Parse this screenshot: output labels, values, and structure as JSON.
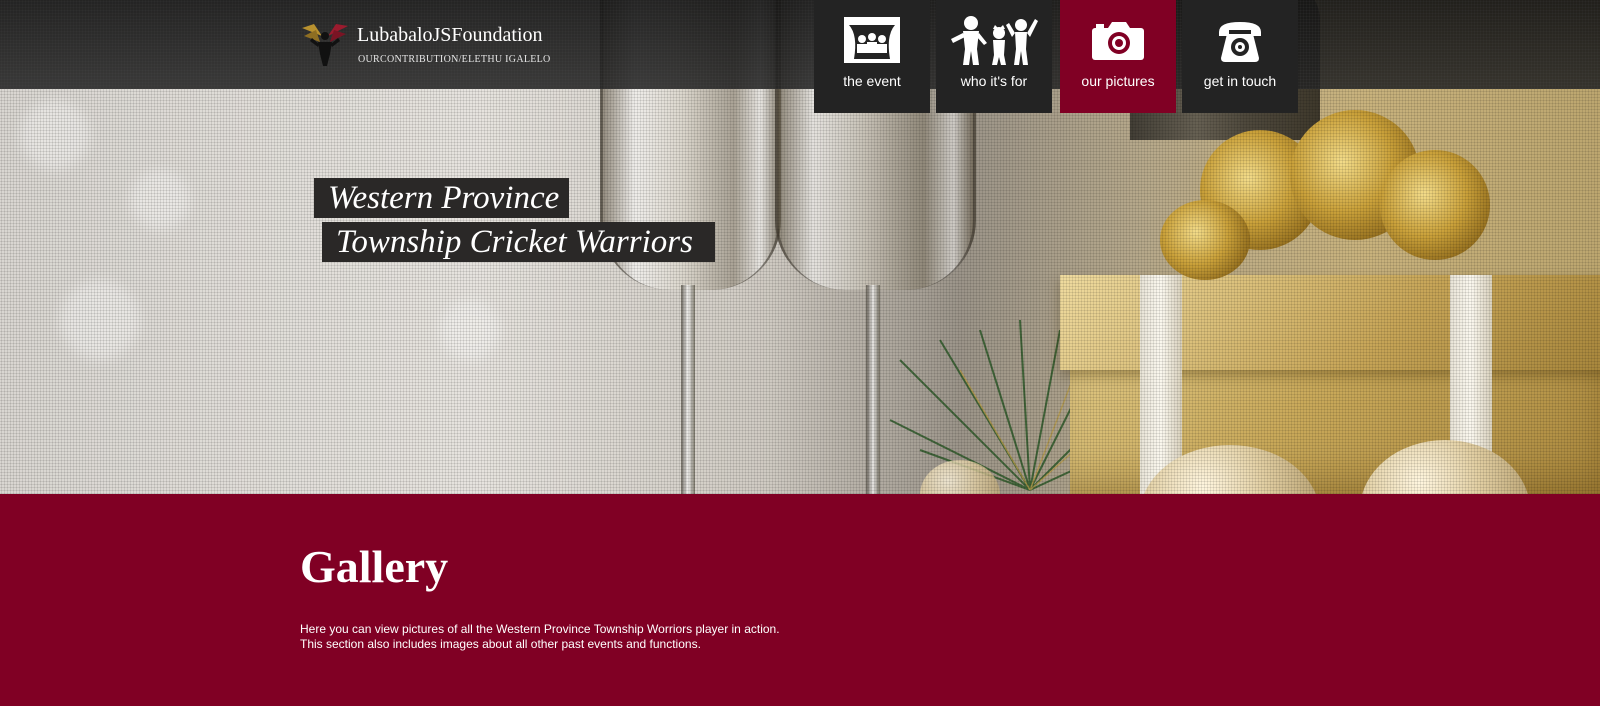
{
  "brand": {
    "logo_icon": "foundation-logo-icon",
    "name": "LubabaloJSFoundation",
    "tagline": "OURCONTRIBUTION/ELETHU IGALELO"
  },
  "nav": {
    "active_index": 2,
    "active_color": "#800024",
    "items": [
      {
        "label": "the event",
        "icon": "theater-audience-icon"
      },
      {
        "label": "who it's for",
        "icon": "children-icon"
      },
      {
        "label": "our pictures",
        "icon": "camera-icon"
      },
      {
        "label": "get in touch",
        "icon": "telephone-icon"
      }
    ]
  },
  "hero": {
    "title_line1": "Western Province",
    "title_line2": "Township Cricket Warriors"
  },
  "gallery": {
    "title": "Gallery",
    "text_line1": "Here you can view pictures of all the Western Province Township Worriors player in action.",
    "text_line2": "This section also includes images about all other past events and functions."
  },
  "colors": {
    "brand_maroon": "#800024",
    "nav_dark": "#232323",
    "topbar_dark": "#1e1e1e",
    "logo_gold": "#b8912f",
    "logo_red": "#9b1b2e"
  }
}
